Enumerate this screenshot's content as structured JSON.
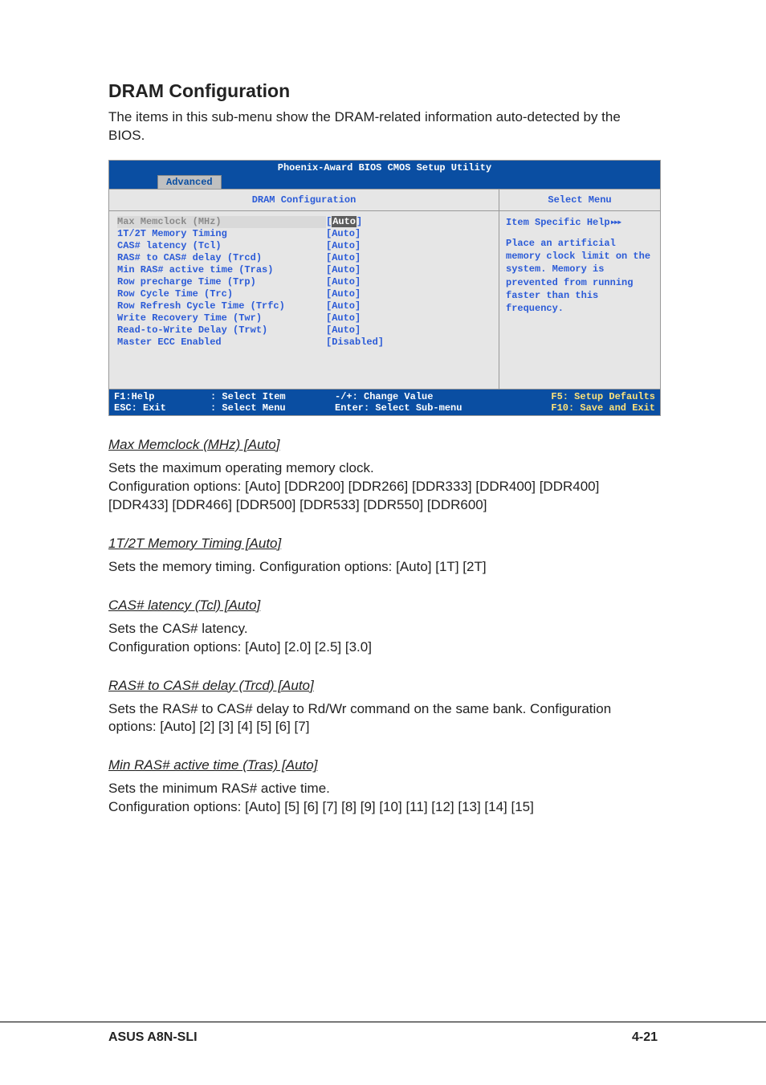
{
  "section": {
    "title": "DRAM Configuration",
    "intro": "The items in this sub-menu show the DRAM-related information auto-detected by the BIOS."
  },
  "bios": {
    "topbar": "Phoenix-Award BIOS CMOS Setup Utility",
    "tab": "Advanced",
    "left_header": "DRAM Configuration",
    "right_header": "Select Menu",
    "settings": [
      {
        "label": "Max Memclock (MHz)",
        "value": "[Auto]",
        "selected": true
      },
      {
        "label": "1T/2T Memory Timing",
        "value": "[Auto]"
      },
      {
        "label": "CAS# latency (Tcl)",
        "value": "[Auto]"
      },
      {
        "label": "RAS# to CAS# delay (Trcd)",
        "value": "[Auto]"
      },
      {
        "label": "Min RAS# active time (Tras)",
        "value": "[Auto]"
      },
      {
        "label": "Row precharge Time (Trp)",
        "value": "[Auto]"
      },
      {
        "label": "Row Cycle Time (Trc)",
        "value": "[Auto]"
      },
      {
        "label": "Row Refresh Cycle Time (Trfc)",
        "value": "[Auto]"
      },
      {
        "label": "Write Recovery Time (Twr)",
        "value": "[Auto]"
      },
      {
        "label": "Read-to-Write Delay (Trwt)",
        "value": "[Auto]"
      },
      {
        "label": "Master ECC Enabled",
        "value": "[Disabled]"
      }
    ],
    "help_title": "Item Specific Help",
    "help_body": "Place an artificial memory clock limit on the system. Memory is prevented from running faster than this frequency.",
    "footer": {
      "r1c1": "F1:Help",
      "r1c2": ": Select Item",
      "r1c3": "-/+:  Change Value",
      "r1c4": "F5: Setup Defaults",
      "r2c1": "ESC: Exit",
      "r2c2": ": Select Menu",
      "r2c3": "Enter: Select Sub-menu",
      "r2c4": "F10: Save and Exit"
    }
  },
  "options": [
    {
      "heading": "Max Memclock (MHz) [Auto]",
      "body": "Sets the maximum operating memory clock.\nConfiguration options: [Auto] [DDR200] [DDR266] [DDR333] [DDR400] [DDR400] [DDR433] [DDR466] [DDR500] [DDR533] [DDR550] [DDR600]"
    },
    {
      "heading": "1T/2T Memory Timing [Auto]",
      "body": "Sets the memory timing. Configuration options: [Auto] [1T] [2T]"
    },
    {
      "heading": "CAS# latency (Tcl) [Auto]",
      "body": "Sets the CAS# latency.\nConfiguration options: [Auto] [2.0] [2.5] [3.0]"
    },
    {
      "heading": "RAS# to CAS# delay (Trcd) [Auto]",
      "body": "Sets the RAS# to CAS# delay to Rd/Wr command on the same bank. Configuration options: [Auto] [2] [3] [4] [5] [6] [7]"
    },
    {
      "heading": "Min RAS# active time (Tras) [Auto]",
      "body": "Sets the minimum RAS# active time.\nConfiguration options: [Auto] [5] [6] [7] [8] [9] [10] [11] [12] [13] [14] [15]"
    }
  ],
  "page_footer": {
    "left": "ASUS A8N-SLI",
    "right": "4-21"
  }
}
